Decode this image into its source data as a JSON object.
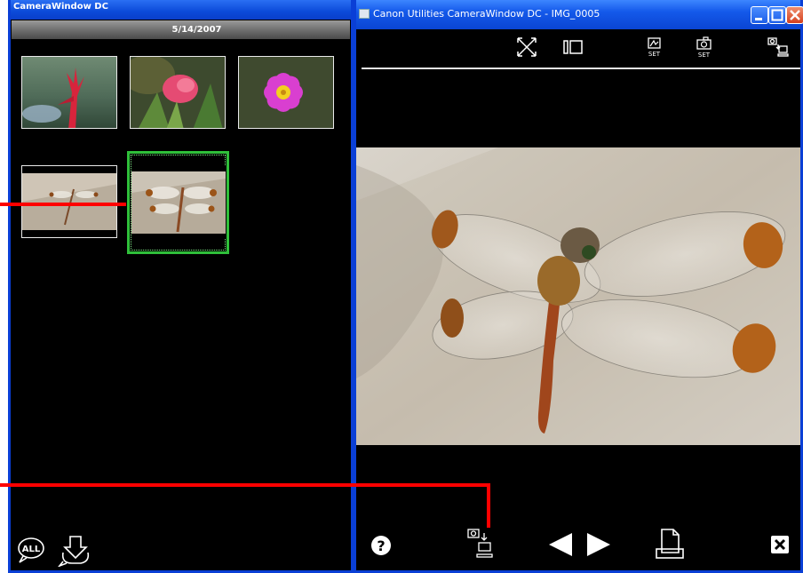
{
  "left_window": {
    "title": "CameraWindow DC",
    "date": "5/14/2007",
    "thumbnails": [
      {
        "subject": "red plant sprout",
        "selected": false
      },
      {
        "subject": "pink flower",
        "selected": false
      },
      {
        "subject": "magenta cosmos flower",
        "selected": false
      },
      {
        "subject": "dragonfly on wood",
        "selected": false
      },
      {
        "subject": "dragonfly on wood",
        "selected": true
      }
    ],
    "bottom_icons": [
      "select-all-icon",
      "download-icon"
    ],
    "select_all_label": "ALL"
  },
  "right_window": {
    "title": "Canon Utilities CameraWindow DC - IMG_0005",
    "toolbar_icons": [
      "fit-screen-icon",
      "single-view-icon",
      "set-icon",
      "camera-set-icon",
      "camera-to-pc-icon"
    ],
    "set_label": "SET",
    "image_subject": "dragonfly close-up on weathered wood",
    "bottom_icons": [
      "help-icon",
      "camera-to-pc-icon",
      "previous-icon",
      "next-icon",
      "print-icon",
      "close-icon"
    ],
    "help_glyph": "?"
  },
  "colors": {
    "title_bar": "#0b4ad9",
    "selection_border": "#2fbf3a",
    "annotation": "#ff0000",
    "background": "#000000"
  }
}
